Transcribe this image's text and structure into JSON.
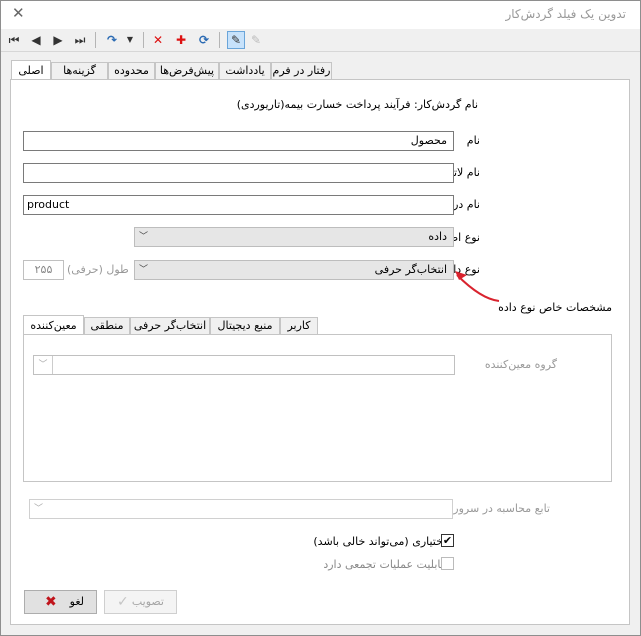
{
  "window": {
    "title": "تدوین یک فیلد گردش‌کار"
  },
  "toolbar": {
    "icons": [
      "first-icon",
      "prev-icon",
      "next-icon",
      "last-icon",
      "redo-icon",
      "dropdown-icon",
      "delete-icon",
      "add-icon",
      "refresh-icon",
      "edit-icon",
      "pen-icon"
    ]
  },
  "tabs": [
    "اصلی",
    "گزینه‌ها",
    "محدوده",
    "پیش‌فرض‌ها",
    "یادداشت",
    "رفتار در فرم"
  ],
  "main": {
    "workflow_label": "نام گردش‌کار: فرآیند پرداخت خسارت بیمه(تاریوردی)",
    "name_label": "نام",
    "name_value": "محصول",
    "latin_name_label": "نام لاتین",
    "latin_name_value": "",
    "program_name_label": "نام در برنامه",
    "program_name_value": "product",
    "info_type_label": "نوع اطلاعاتی",
    "info_type_value": "داده",
    "data_type_label": "نوع داده",
    "data_type_value": "انتخاب‌گر حرفی",
    "length_label": "طول (حرفی)",
    "length_value": "۲۵۵",
    "annotation": "مشخصات خاص نوع داده"
  },
  "subtabs": [
    "معین‌کننده",
    "منطقی",
    "انتخاب‌گر حرفی",
    "منبع دیجیتال",
    "کاربر"
  ],
  "subpage": {
    "group_label": "گروه معین‌کننده",
    "group_value": ""
  },
  "server_func_label": "تابع محاسبه در سرور",
  "optional_label": "اختیاری (می‌تواند خالی باشد)",
  "optional_checked": "✔",
  "aggregate_label": "قابلیت عملیات تجمعی دارد",
  "buttons": {
    "approve": "تصویب",
    "cancel": "لغو"
  },
  "colors": {
    "arrow": "#d9232e",
    "cancel_icon": "#c0141c",
    "selected": "#c7e2fb"
  }
}
